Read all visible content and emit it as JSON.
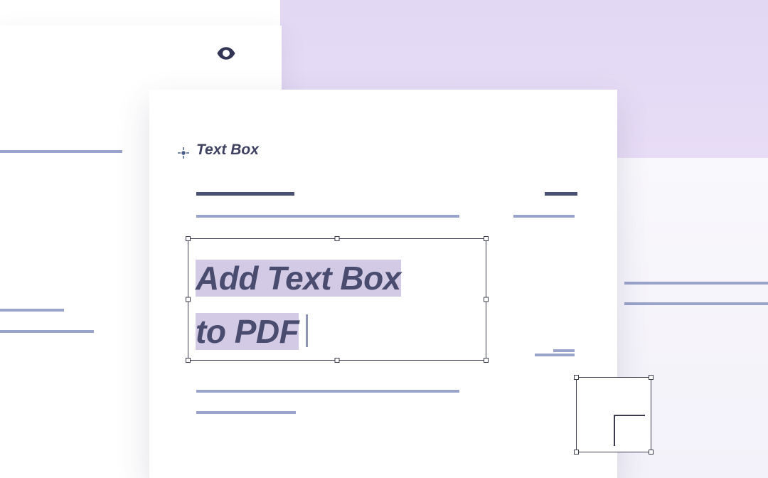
{
  "label": "Text Box",
  "textbox": {
    "line1": "Add Text Box",
    "line2": "to PDF"
  },
  "colors": {
    "selection": "#d3cbe5",
    "text": "#4a4c6f",
    "lavender": "#e2d8f4",
    "handle_border": "#3c3d4f"
  }
}
